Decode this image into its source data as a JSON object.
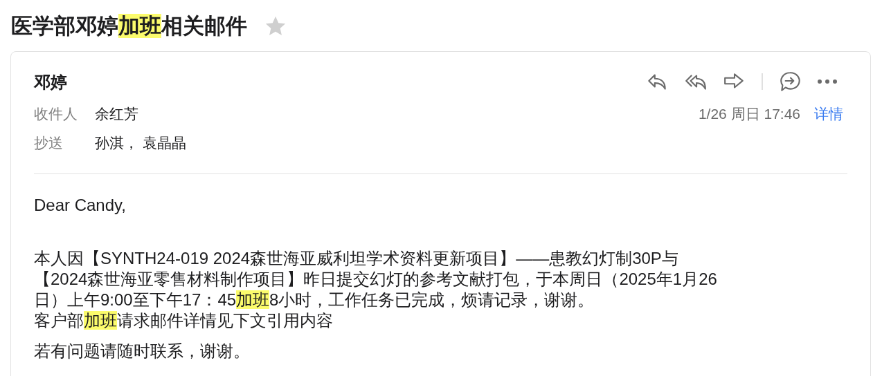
{
  "subject": {
    "segments": [
      {
        "text": "医学部邓婷",
        "highlighted": false
      },
      {
        "text": "加班",
        "highlighted": true
      },
      {
        "text": "相关邮件",
        "highlighted": false
      }
    ],
    "starred": false
  },
  "message": {
    "sender": "邓婷",
    "recipients": [
      {
        "label": "收件人",
        "names": "余红芳"
      },
      {
        "label": "抄送",
        "names": "孙淇， 袁晶晶"
      }
    ],
    "date": "1/26 周日 17:46",
    "details_link": "详情",
    "body": [
      {
        "kind": "greeting",
        "lines": [
          [
            {
              "text": "Dear Candy,",
              "highlighted": false
            }
          ]
        ]
      },
      {
        "kind": "paragraph",
        "lines": [
          [
            {
              "text": "本人因【SYNTH24-019 2024森世海亚威利坦学术资料更新项目】——患教幻灯制30P与",
              "highlighted": false
            }
          ],
          [
            {
              "text": "【2024森世海亚零售材料制作项目】昨日提交幻灯的参考文献打包，于本周日（2025年1月26",
              "highlighted": false
            }
          ],
          [
            {
              "text": "日）上午9:00至下午17：45",
              "highlighted": false
            },
            {
              "text": "加班",
              "highlighted": true
            },
            {
              "text": "8小时，工作任务已完成，烦请记录，谢谢。",
              "highlighted": false
            }
          ],
          [
            {
              "text": "客户部",
              "highlighted": false
            },
            {
              "text": "加班",
              "highlighted": true
            },
            {
              "text": "请求邮件详情见下文引用内容",
              "highlighted": false
            }
          ]
        ]
      },
      {
        "kind": "line",
        "lines": [
          [
            {
              "text": "若有问题请随时联系，谢谢。",
              "highlighted": false
            }
          ]
        ]
      }
    ]
  }
}
